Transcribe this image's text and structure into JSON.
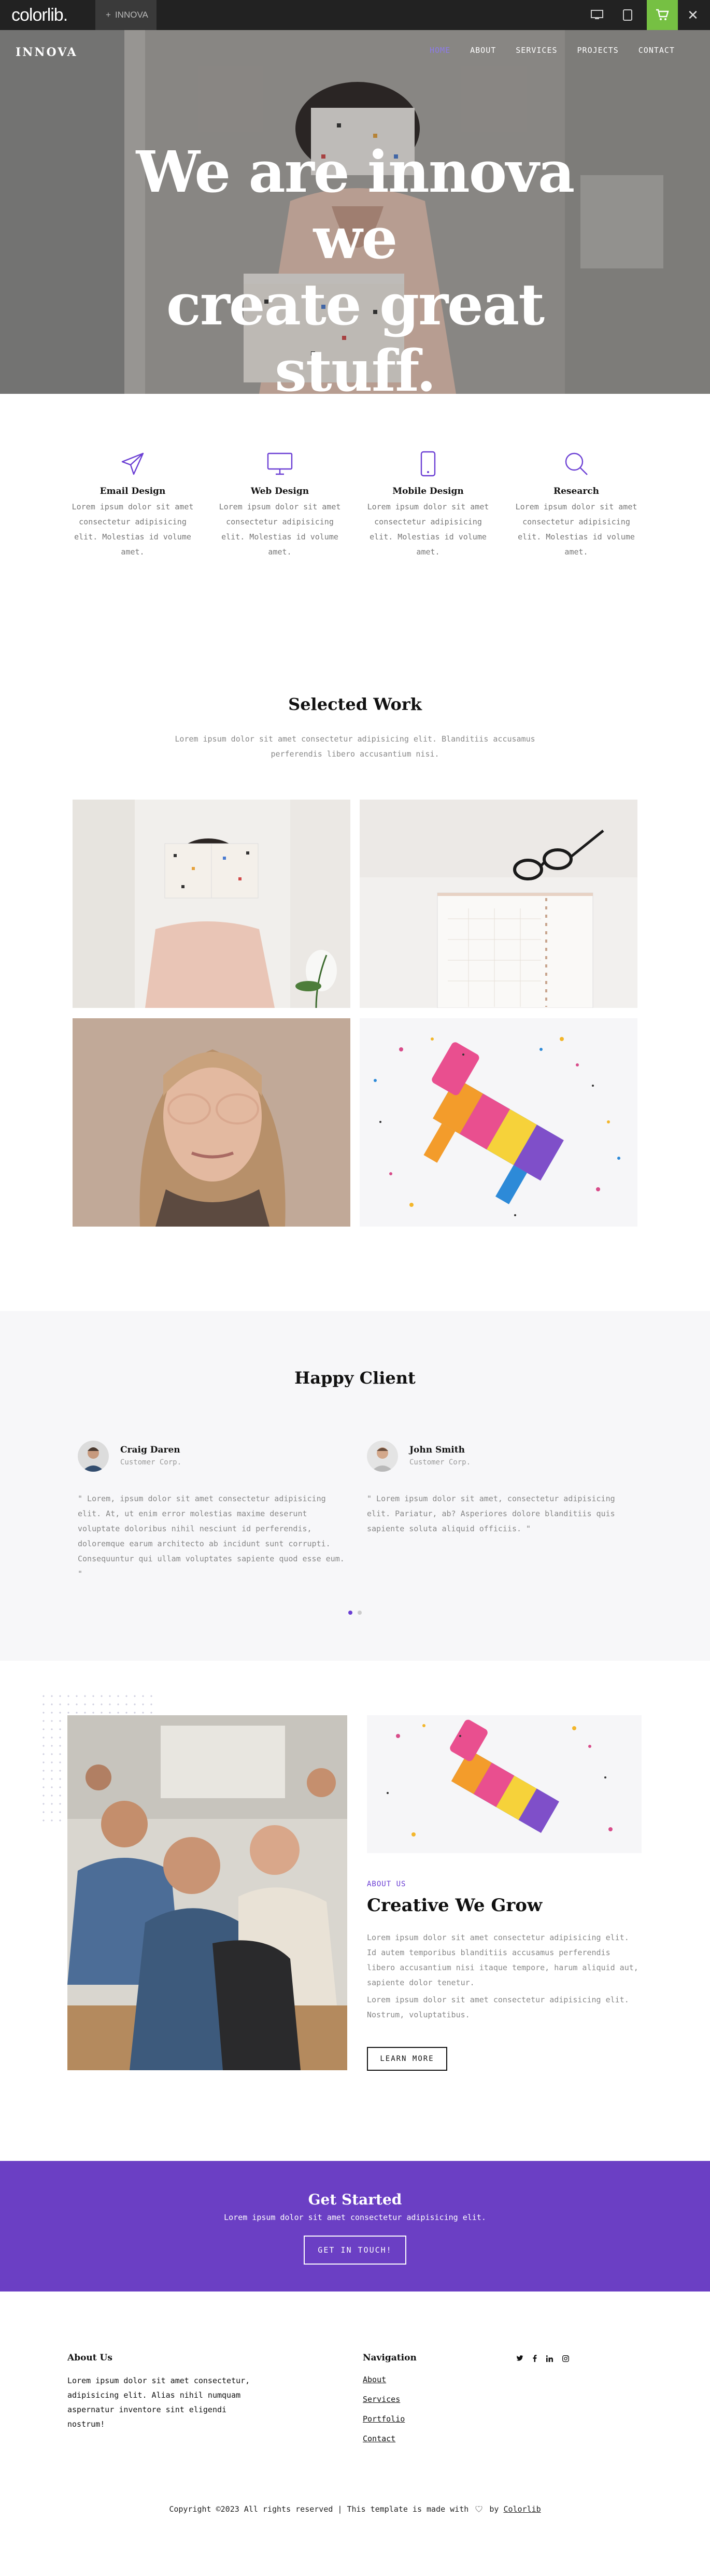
{
  "topbar": {
    "logo": "colorlib.",
    "tab_label": "INNOVA",
    "device_icons": [
      "desktop-icon",
      "tablet-icon",
      "mobile-icon"
    ],
    "accent": "#76c043"
  },
  "header": {
    "brand": "INNOVA",
    "nav": [
      {
        "label": "HOME",
        "active": true
      },
      {
        "label": "ABOUT",
        "active": false
      },
      {
        "label": "SERVICES",
        "active": false
      },
      {
        "label": "PROJECTS",
        "active": false
      },
      {
        "label": "CONTACT",
        "active": false
      }
    ],
    "accent": "#8c7be8"
  },
  "hero": {
    "title_line1": "We are innova we",
    "title_line2": "create great stuff."
  },
  "services": [
    {
      "icon": "paper-plane-icon",
      "title": "Email Design",
      "text": "Lorem ipsum dolor sit amet consectetur adipisicing elit. Molestias id volume amet."
    },
    {
      "icon": "monitor-icon",
      "title": "Web Design",
      "text": "Lorem ipsum dolor sit amet consectetur adipisicing elit. Molestias id volume amet."
    },
    {
      "icon": "smartphone-icon",
      "title": "Mobile Design",
      "text": "Lorem ipsum dolor sit amet consectetur adipisicing elit. Molestias id volume amet."
    },
    {
      "icon": "search-icon",
      "title": "Research",
      "text": "Lorem ipsum dolor sit amet consectetur adipisicing elit. Molestias id volume amet."
    }
  ],
  "work": {
    "title": "Selected Work",
    "lead": "Lorem ipsum dolor sit amet consectetur adipisicing elit. Blanditiis accusamus perferendis libero accusantium nisi."
  },
  "clients": {
    "title": "Happy Client",
    "items": [
      {
        "name": "Craig Daren",
        "company": "Customer Corp.",
        "quote": "\" Lorem, ipsum dolor sit amet consectetur adipisicing elit. At, ut enim error molestias maxime deserunt voluptate doloribus nihil nesciunt id perferendis, doloremque earum architecto ab incidunt sunt corrupti. Consequuntur qui ullam voluptates sapiente quod esse eum. \""
      },
      {
        "name": "John Smith",
        "company": "Customer Corp.",
        "quote": "\" Lorem ipsum dolor sit amet, consectetur adipisicing elit. Pariatur, ab? Asperiores dolore blanditiis quis sapiente soluta aliquid officiis. \""
      }
    ],
    "pager_active": 1,
    "pager_count": 2
  },
  "about": {
    "eyebrow": "ABOUT US",
    "title": "Creative We Grow",
    "p1": "Lorem ipsum dolor sit amet consectetur adipisicing elit. Id autem temporibus blanditiis accusamus perferendis libero accusantium nisi itaque tempore, harum aliquid aut, sapiente dolor tenetur.",
    "p2": "Lorem ipsum dolor sit amet consectetur adipisicing elit. Nostrum, voluptatibus.",
    "button": "LEARN MORE"
  },
  "cta": {
    "title": "Get Started",
    "text": "Lorem ipsum dolor sit amet consectetur adipisicing elit.",
    "button": "GET IN TOUCH!",
    "bg": "#6b3fc4"
  },
  "footer": {
    "about_title": "About Us",
    "about_text": "Lorem ipsum dolor sit amet consectetur, adipisicing elit. Alias nihil numquam aspernatur inventore sint eligendi nostrum!",
    "nav_title": "Navigation",
    "links": [
      "About",
      "Services",
      "Portfolio",
      "Contact"
    ],
    "social_icons": [
      "twitter-icon",
      "facebook-icon",
      "linkedin-icon",
      "instagram-icon"
    ],
    "copy_prefix": "Copyright ©2023 All rights reserved | This template is made with",
    "copy_by": "by",
    "copy_brand": "Colorlib"
  }
}
